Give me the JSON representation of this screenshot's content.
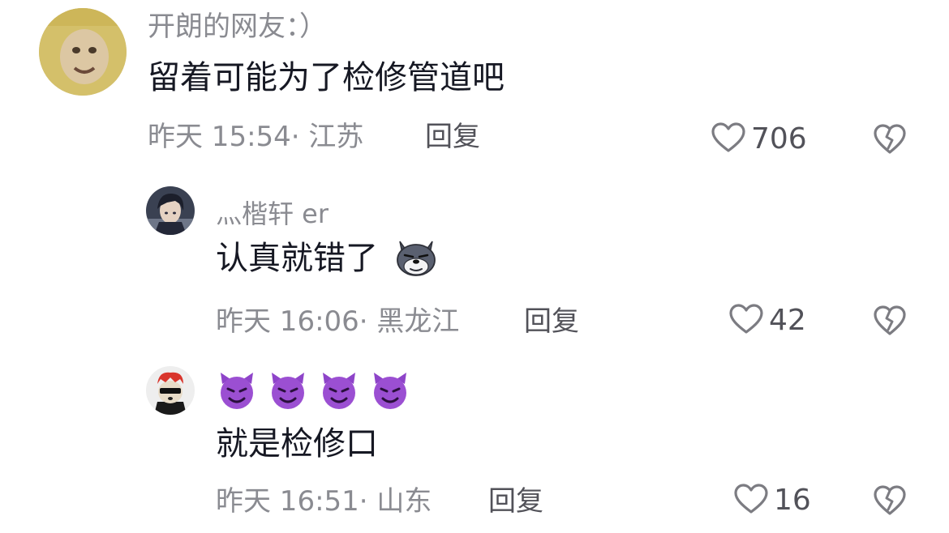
{
  "colors": {
    "text_primary": "#161823",
    "text_secondary": "#8a8b91",
    "action": "#525259",
    "icon_stroke": "#7c7c82"
  },
  "icons": {
    "like": "heart-outline-icon",
    "dislike": "broken-heart-icon",
    "emoji_wolf": "wolf-emoji",
    "emoji_devil": "smiling-devil-emoji"
  },
  "comments": [
    {
      "username": "开朗的网友：）",
      "text": "留着可能为了检修管道吧",
      "time": "昨天 15:54",
      "separator": "·",
      "location": "江苏",
      "reply_label": "回复",
      "likes": "706"
    },
    {
      "username": "灬楷轩 er",
      "text": "认真就错了",
      "time": "昨天 16:06",
      "separator": "·",
      "location": "黑龙江",
      "reply_label": "回复",
      "likes": "42"
    },
    {
      "username": "",
      "text": "就是检修口",
      "time": "昨天 16:51",
      "separator": "·",
      "location": "山东",
      "reply_label": "回复",
      "likes": "16"
    }
  ]
}
